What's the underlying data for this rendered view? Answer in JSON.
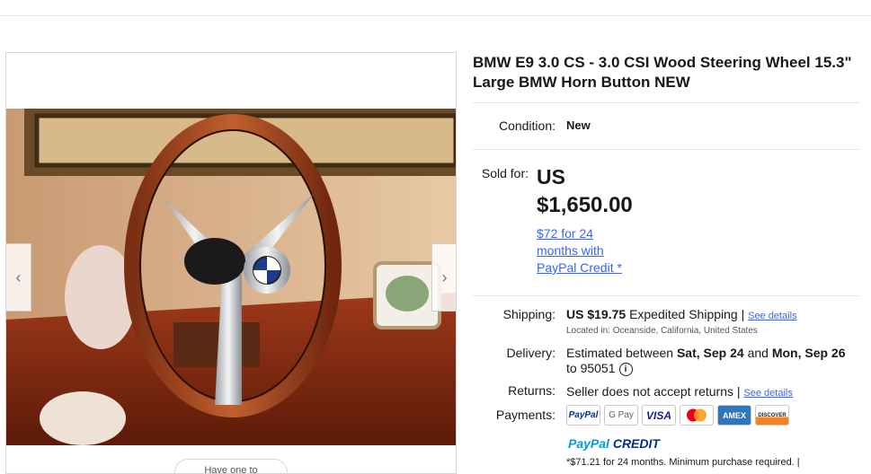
{
  "listing": {
    "title": "BMW E9 3.0 CS - 3.0 CSI Wood Steering Wheel 15.3\" Large BMW Horn Button NEW"
  },
  "gallery": {
    "prev_arrow": "‹",
    "next_arrow": "›",
    "pill_label": "Have one to"
  },
  "condition": {
    "label": "Condition:",
    "value": "New"
  },
  "price": {
    "label": "Sold for:",
    "currency": "US",
    "amount": "$1,650.00",
    "financing_link": "$72 for 24 months with PayPal Credit",
    "financing_star": "*"
  },
  "shipping": {
    "label": "Shipping:",
    "amount": "US $19.75",
    "method": "Expedited Shipping",
    "separator": "|",
    "details_link": "See details",
    "location": "Located in: Oceanside, California, United States"
  },
  "delivery": {
    "label": "Delivery:",
    "prefix": "Estimated between",
    "start": "Sat, Sep 24",
    "and": "and",
    "end": "Mon, Sep 26",
    "to": "to 95051"
  },
  "returns": {
    "label": "Returns:",
    "value": "Seller does not accept returns",
    "separator": "|",
    "details_link": "See details"
  },
  "payments": {
    "label": "Payments:",
    "methods": [
      "PayPal",
      "G Pay",
      "VISA",
      "Mastercard",
      "AMEX",
      "DISCOVER"
    ],
    "credit_brand": "PayPal",
    "credit_word": "CREDIT",
    "footnote": "*$71.21 for 24 months. Minimum purchase required. |"
  }
}
